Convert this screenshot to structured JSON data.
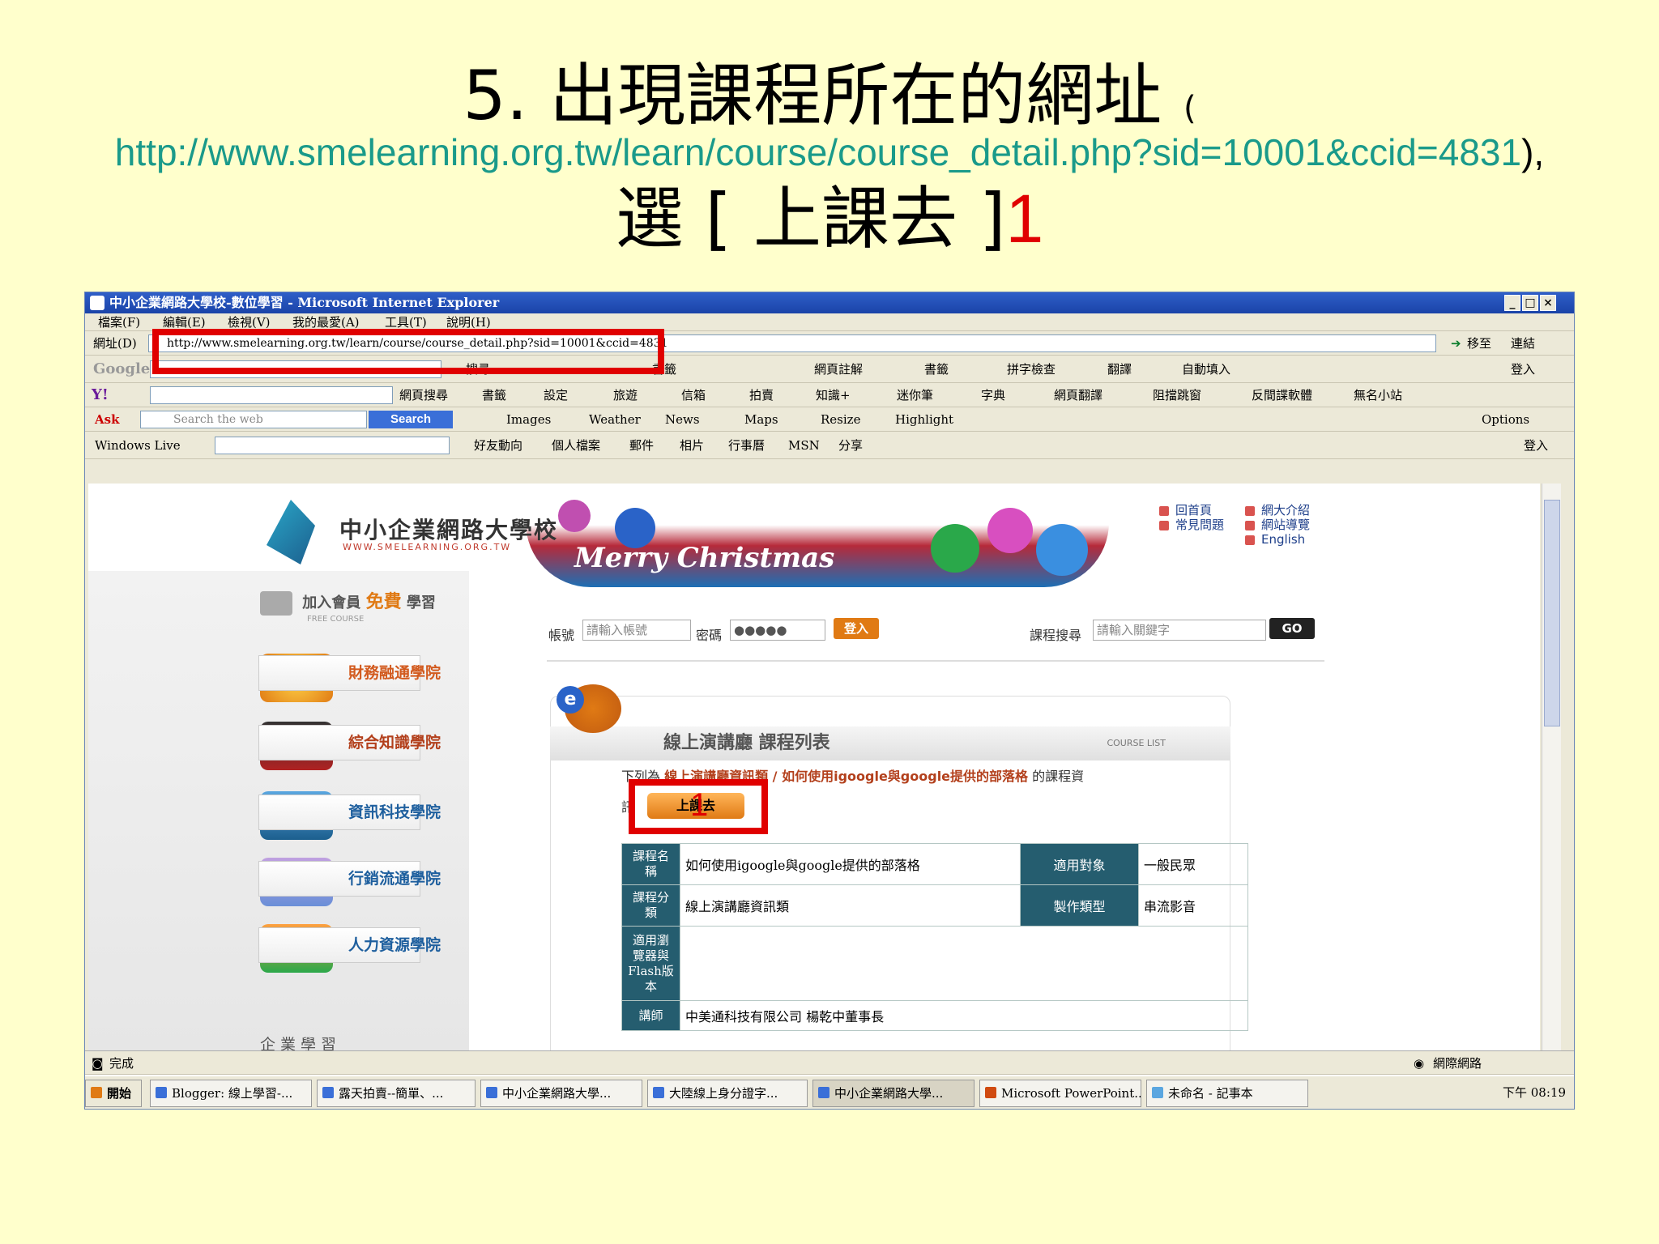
{
  "slide": {
    "title_main": "5. 出現課程所在的網址",
    "title_paren_open": "(",
    "url": "http://www.smelearning.org.tw/learn/course/course_detail.php?sid=10001&ccid=4831",
    "url_tail": "),",
    "line3_text": "選 [ 上課去 ]",
    "line3_num": "1"
  },
  "window": {
    "title": "中小企業網路大學校-數位學習 - Microsoft Internet Explorer",
    "menu": [
      "檔案(F)",
      "編輯(E)",
      "檢視(V)",
      "我的最愛(A)",
      "工具(T)",
      "說明(H)"
    ],
    "address_label": "網址(D)",
    "address_value": "http://www.smelearning.org.tw/learn/course/course_detail.php?sid=10001&ccid=4831",
    "go_label": "移至",
    "links_label": "連結"
  },
  "google_bar": {
    "logo": "Google",
    "search": "搜尋",
    "items": [
      "書籤",
      "網頁註解",
      "書籤",
      "拼字檢查",
      "翻譯",
      "自動填入"
    ],
    "login": "登入"
  },
  "yahoo_bar": {
    "search_btn": "網頁搜尋",
    "items": [
      "書籤",
      "設定",
      "旅遊",
      "信箱",
      "拍賣",
      "知識+",
      "迷你筆",
      "字典",
      "網頁翻譯",
      "阻擋跳窗",
      "反間諜軟體",
      "無名小站"
    ]
  },
  "ask_bar": {
    "placeholder": "Search the web",
    "search_btn": "Search",
    "items": [
      "Images",
      "Weather",
      "News",
      "Maps",
      "Resize",
      "Highlight"
    ],
    "options": "Options"
  },
  "wl_bar": {
    "label": "Windows Live",
    "items": [
      "好友動向",
      "個人檔案",
      "郵件",
      "相片",
      "行事曆",
      "MSN",
      "分享"
    ],
    "login": "登入"
  },
  "site": {
    "name": "中小企業網路大學校",
    "subname": "WWW.SMELEARNING.ORG.TW",
    "xmas_text": "Merry Christmas",
    "top_links": [
      "回首頁",
      "常見問題",
      "網大介紹",
      "網站導覽",
      "English"
    ],
    "join_title": "加入會員",
    "join_free": "免費",
    "join_learn": "學習",
    "join_sub": "FREE COURSE",
    "colleges": [
      "財務融通學院",
      "綜合知識學院",
      "資訊科技學院",
      "行銷流通學院",
      "人力資源學院"
    ],
    "enterprise": "企業學習",
    "account_label": "帳號",
    "account_placeholder": "請輸入帳號",
    "password_label": "密碼",
    "password_value": "●●●●●",
    "login_btn": "登入",
    "course_search_label": "課程搜尋",
    "course_search_placeholder": "請輸入關鍵字",
    "go_btn": "GO",
    "panel_title": "線上演講廳  課程列表",
    "panel_tag": "COURSE LIST",
    "desc_prefix": "下列為",
    "desc_link": "線上演講廳資訊類 / 如何使用igoogle與google提供的部落格",
    "desc_suffix": "的課程資",
    "desc_line2": "訊",
    "go_class_btn": "上課去",
    "marker": "1",
    "table": {
      "r1": {
        "h": "課程名稱",
        "v": "如何使用igoogle與google提供的部落格",
        "h2": "適用對象",
        "v2": "一般民眾"
      },
      "r2": {
        "h": "課程分類",
        "v": "線上演講廳資訊類",
        "h2": "製作類型",
        "v2": "串流影音"
      },
      "r3": {
        "h": "適用瀏覽器與Flash版本",
        "v": ""
      },
      "r4": {
        "h": "講師",
        "v": "中美通科技有限公司 楊乾中董事長"
      }
    }
  },
  "status": {
    "text": "完成",
    "zone": "網際網路"
  },
  "taskbar": {
    "start": "開始",
    "tasks": [
      "Blogger: 線上學習-...",
      "露天拍賣--簡單、...",
      "中小企業網路大學...",
      "大陸線上身分證字...",
      "中小企業網路大學...",
      "Microsoft PowerPoint...",
      "未命名 - 記事本"
    ],
    "clock": "下午 08:19"
  },
  "colors": {
    "highlight": "#e00000",
    "url": "#1a9a8a",
    "table_header": "#255d6f"
  }
}
